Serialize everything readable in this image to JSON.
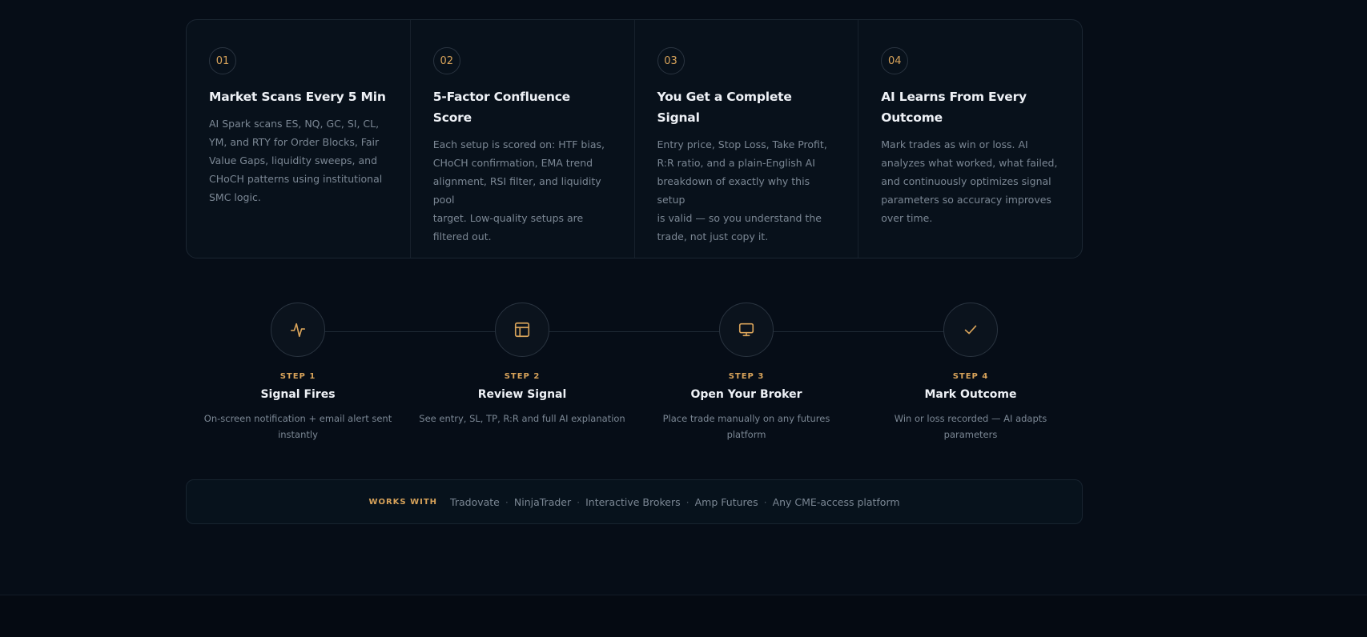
{
  "cards": [
    {
      "number": "01",
      "title": "Market Scans Every 5 Min",
      "desc_lines": [
        "AI Spark scans ES, NQ, GC, SI, CL,",
        "YM, and RTY for Order Blocks, Fair",
        "Value Gaps, liquidity sweeps, and",
        "CHoCH patterns using institutional",
        "SMC logic."
      ]
    },
    {
      "number": "02",
      "title": "5-Factor Confluence Score",
      "desc_lines": [
        "Each setup is scored on: HTF bias,",
        "CHoCH confirmation, EMA trend",
        "alignment, RSI filter, and liquidity pool",
        "target. Low-quality setups are",
        "filtered out."
      ]
    },
    {
      "number": "03",
      "title": "You Get a Complete Signal",
      "desc_lines": [
        "Entry price, Stop Loss, Take Profit,",
        "R:R ratio, and a plain-English AI",
        "breakdown of exactly why this setup",
        "is valid — so you understand the",
        "trade, not just copy it."
      ]
    },
    {
      "number": "04",
      "title_lines": [
        "AI Learns From Every",
        "Outcome"
      ],
      "desc_lines": [
        "Mark trades as win or loss. AI",
        "analyzes what worked, what failed,",
        "and continuously optimizes signal",
        "parameters so accuracy improves",
        "over time."
      ]
    }
  ],
  "steps": [
    {
      "icon": "activity-icon",
      "label": "STEP 1",
      "title": "Signal Fires",
      "desc_lines": [
        "On-screen notification + email alert sent",
        "instantly"
      ]
    },
    {
      "icon": "layout-icon",
      "label": "STEP 2",
      "title": "Review Signal",
      "desc_lines": [
        "See entry, SL, TP, R:R and full AI explanation"
      ]
    },
    {
      "icon": "monitor-icon",
      "label": "STEP 3",
      "title": "Open Your Broker",
      "desc_lines": [
        "Place trade manually on any futures platform"
      ]
    },
    {
      "icon": "check-icon",
      "label": "STEP 4",
      "title": "Mark Outcome",
      "desc_lines": [
        "Win or loss recorded — AI adapts parameters"
      ]
    }
  ],
  "works_with": {
    "label": "WORKS WITH",
    "separator": "·",
    "platforms": [
      "Tradovate",
      "NinjaTrader",
      "Interactive Brokers",
      "Amp Futures",
      "Any CME-access platform"
    ]
  },
  "colors": {
    "background": "#060d17",
    "accent": "#d8a35a",
    "heading": "#eef1f6",
    "muted_text": "#7b8794"
  }
}
